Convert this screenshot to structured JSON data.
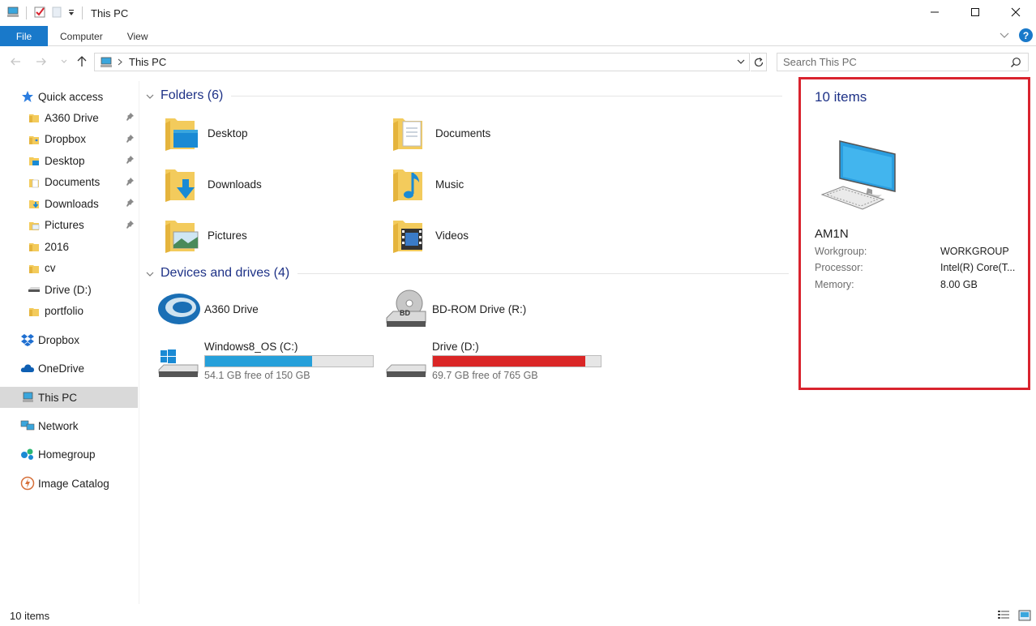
{
  "window": {
    "title": "This PC",
    "minimize_label": "Minimize",
    "maximize_label": "Maximize",
    "close_label": "Close"
  },
  "ribbon": {
    "tabs": [
      {
        "label": "File"
      },
      {
        "label": "Computer"
      },
      {
        "label": "View"
      }
    ],
    "help_label": "?"
  },
  "address": {
    "crumb": "This PC",
    "search_placeholder": "Search This PC"
  },
  "nav": {
    "quick_access": "Quick access",
    "quick_items": [
      {
        "label": "A360 Drive",
        "pinned": true
      },
      {
        "label": "Dropbox",
        "pinned": true
      },
      {
        "label": "Desktop",
        "pinned": true
      },
      {
        "label": "Documents",
        "pinned": true
      },
      {
        "label": "Downloads",
        "pinned": true
      },
      {
        "label": "Pictures",
        "pinned": true
      },
      {
        "label": "2016",
        "pinned": false
      },
      {
        "label": "cv",
        "pinned": false
      },
      {
        "label": "Drive (D:)",
        "pinned": false
      },
      {
        "label": "portfolio",
        "pinned": false
      }
    ],
    "dropbox": "Dropbox",
    "onedrive": "OneDrive",
    "thispc": "This PC",
    "network": "Network",
    "homegroup": "Homegroup",
    "image_catalog": "Image Catalog"
  },
  "content": {
    "folders_header": "Folders (6)",
    "folders": [
      {
        "label": "Desktop",
        "icon": "desktop-folder-icon"
      },
      {
        "label": "Documents",
        "icon": "documents-folder-icon"
      },
      {
        "label": "Downloads",
        "icon": "downloads-folder-icon"
      },
      {
        "label": "Music",
        "icon": "music-folder-icon"
      },
      {
        "label": "Pictures",
        "icon": "pictures-folder-icon"
      },
      {
        "label": "Videos",
        "icon": "videos-folder-icon"
      }
    ],
    "devices_header": "Devices and drives (4)",
    "drives": [
      {
        "label": "A360 Drive",
        "icon": "a360-drive-icon"
      },
      {
        "label": "BD-ROM Drive (R:)",
        "icon": "bd-rom-drive-icon"
      },
      {
        "label": "Windows8_OS (C:)",
        "free": "54.1 GB free of 150 GB",
        "used_fraction": 0.64,
        "color": "#26a0da",
        "icon": "windows-drive-icon"
      },
      {
        "label": "Drive (D:)",
        "free": "69.7 GB free of 765 GB",
        "used_fraction": 0.909,
        "color": "#da2626",
        "icon": "hard-drive-icon"
      }
    ]
  },
  "details": {
    "count": "10 items",
    "name": "AM1N",
    "rows": [
      {
        "key": "Workgroup:",
        "value": "WORKGROUP"
      },
      {
        "key": "Processor:",
        "value": "Intel(R) Core(T..."
      },
      {
        "key": "Memory:",
        "value": "8.00 GB"
      }
    ]
  },
  "status": {
    "count": "10 items"
  },
  "colors": {
    "accent": "#1979ca",
    "group_title": "#1e3287",
    "highlight_border": "#d9232e"
  }
}
